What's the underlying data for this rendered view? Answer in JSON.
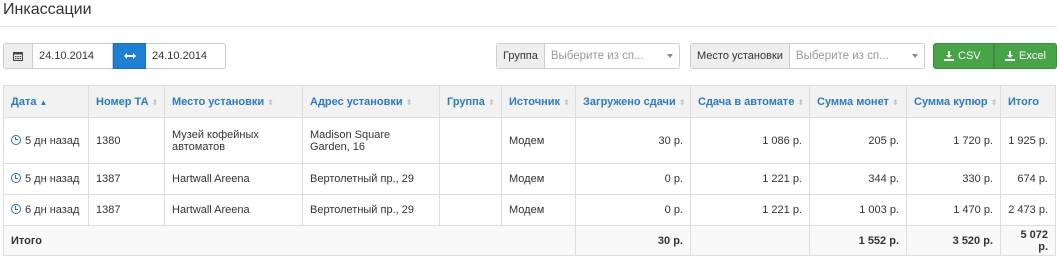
{
  "page": {
    "title": "Инкассации"
  },
  "filters": {
    "date_from": "24.10.2014",
    "date_to": "24.10.2014",
    "group": {
      "label": "Группа",
      "placeholder": "Выберите из сп..."
    },
    "place": {
      "label": "Место установки",
      "placeholder": "Выберите из сп..."
    }
  },
  "export": {
    "csv": "CSV",
    "excel": "Excel"
  },
  "table": {
    "headers": {
      "date": "Дата",
      "ta": "Номер ТА",
      "place": "Место установки",
      "address": "Адрес установки",
      "group": "Группа",
      "source": "Источник",
      "loaded": "Загружено сдачи",
      "change": "Сдача в автомате",
      "coins": "Сумма монет",
      "bills": "Сумма купюр",
      "total": "Итого"
    },
    "rows": [
      {
        "date": "5 дн назад",
        "ta": "1380",
        "place": "Музей кофейных автоматов",
        "address": "Madison Square Garden, 16",
        "group": "",
        "source": "Модем",
        "loaded": "30 р.",
        "change": "1 086 р.",
        "coins": "205 р.",
        "bills": "1 720 р.",
        "total": "1 925 р."
      },
      {
        "date": "5 дн назад",
        "ta": "1387",
        "place": "Hartwall Areena",
        "address": "Вертолетный пр., 29",
        "group": "",
        "source": "Модем",
        "loaded": "0 р.",
        "change": "1 221 р.",
        "coins": "344 р.",
        "bills": "330 р.",
        "total": "674 р."
      },
      {
        "date": "6 дн назад",
        "ta": "1387",
        "place": "Hartwall Areena",
        "address": "Вертолетный пр., 29",
        "group": "",
        "source": "Модем",
        "loaded": "0 р.",
        "change": "1 221 р.",
        "coins": "1 003 р.",
        "bills": "1 470 р.",
        "total": "2 473 р."
      }
    ],
    "footer": {
      "label": "Итого",
      "loaded": "30 р.",
      "coins": "1 552 р.",
      "bills": "3 520 р.",
      "total": "5 072 р."
    }
  }
}
